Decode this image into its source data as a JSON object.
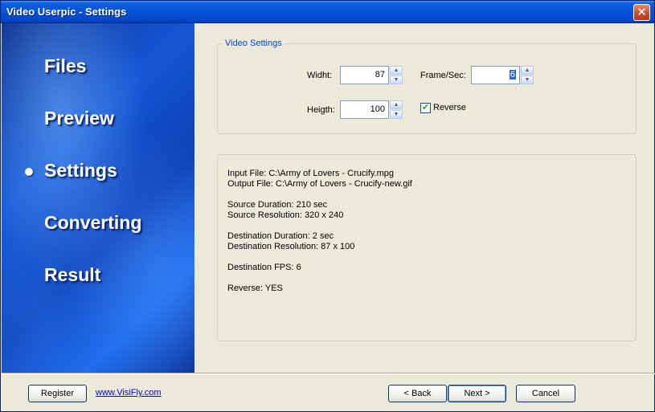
{
  "window": {
    "title": "Video Userpic - Settings",
    "close_glyph": "✕"
  },
  "sidebar": {
    "items": [
      {
        "label": "Files",
        "active": false
      },
      {
        "label": "Preview",
        "active": false
      },
      {
        "label": "Settings",
        "active": true
      },
      {
        "label": "Converting",
        "active": false
      },
      {
        "label": "Result",
        "active": false
      }
    ]
  },
  "video_settings": {
    "legend": "Video Settings",
    "width_label": "Widht:",
    "width_value": "87",
    "height_label": "Heigth:",
    "height_value": "100",
    "fps_label": "Frame/Sec:",
    "fps_value": "6",
    "reverse_label": "Reverse",
    "reverse_checked": true
  },
  "info": {
    "input_file": "Input File: C:\\Army of Lovers - Crucify.mpg",
    "output_file": "Output File: C:\\Army of Lovers - Crucify-new.gif",
    "source_duration": "Source Duration: 210 sec",
    "source_resolution": "Source Resolution: 320 x 240",
    "destination_duration": "Destination Duration: 2 sec",
    "destination_resolution": "Destination Resolution: 87 x 100",
    "destination_fps": "Destination FPS: 6",
    "reverse": "Reverse: YES"
  },
  "footer": {
    "register_label": "Register",
    "link_text": "www.VisiFly.com",
    "back_label": "< Back",
    "next_label": "Next >",
    "cancel_label": "Cancel"
  },
  "colors": {
    "titlebar": "#0653d8",
    "legend": "#0046d5",
    "sidebar": "#1457d6",
    "link": "#0000ee"
  }
}
